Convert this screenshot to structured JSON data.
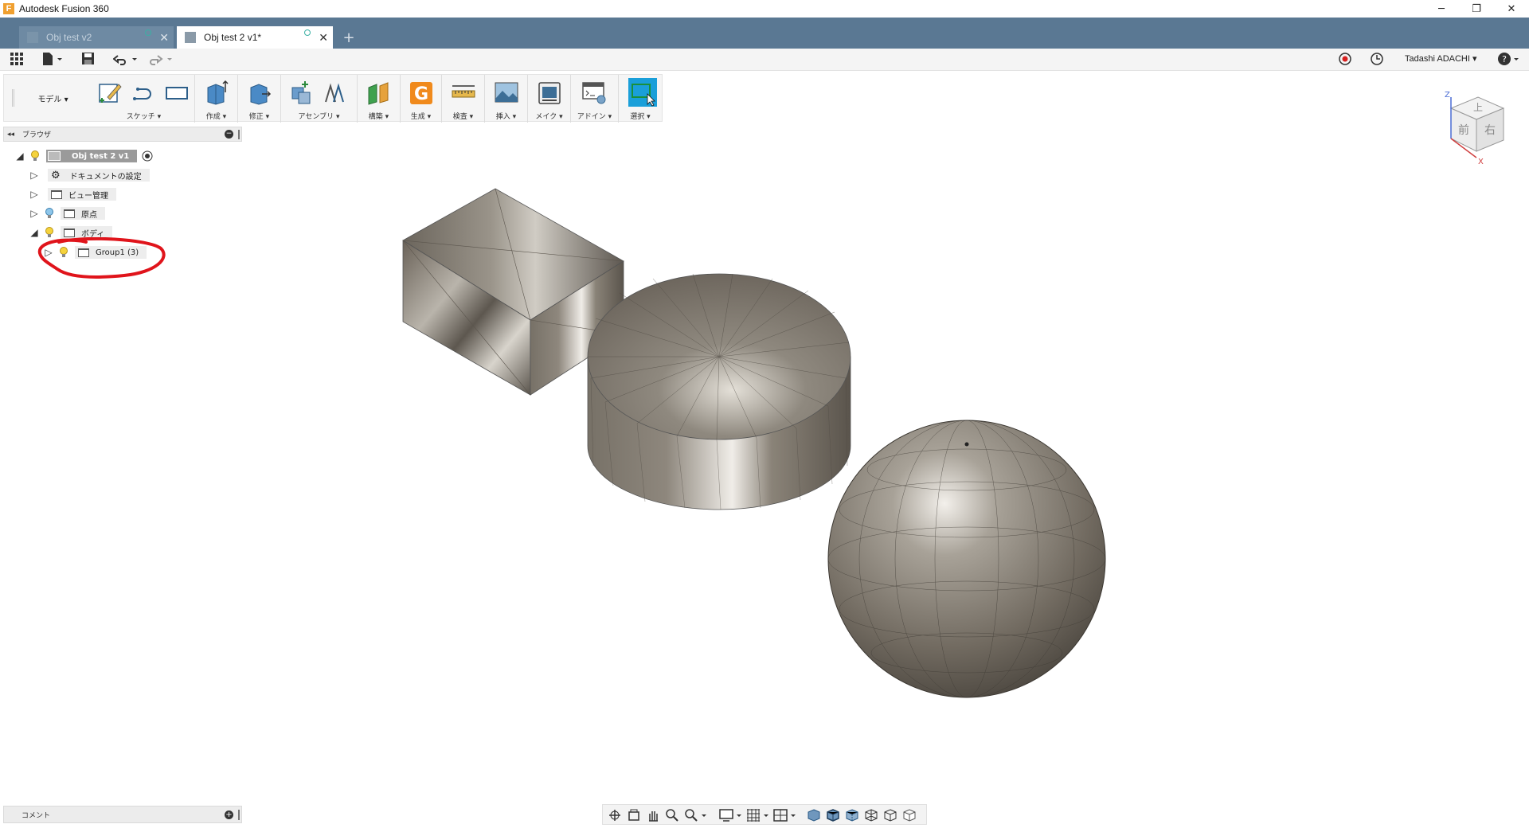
{
  "window": {
    "title": "Autodesk Fusion 360",
    "logo_letter": "F"
  },
  "window_controls": {
    "minimize": "─",
    "restore": "❐",
    "close": "✕"
  },
  "tabs": [
    {
      "label": "Obj test v2",
      "active": false
    },
    {
      "label": "Obj test 2 v1*",
      "active": true
    }
  ],
  "tab_add": "+",
  "quick_access": {
    "user": "Tadashi ADACHI ▾",
    "help": "?▾"
  },
  "toolbar": {
    "workspace": "モデル ▾",
    "groups": [
      {
        "label": "スケッチ ▾"
      },
      {
        "label": "作成 ▾"
      },
      {
        "label": "修正 ▾"
      },
      {
        "label": "アセンブリ ▾"
      },
      {
        "label": "構築 ▾"
      },
      {
        "label": "生成 ▾"
      },
      {
        "label": "検査 ▾"
      },
      {
        "label": "挿入 ▾"
      },
      {
        "label": "メイク ▾"
      },
      {
        "label": "アドイン ▾"
      },
      {
        "label": "選択 ▾"
      }
    ]
  },
  "browser": {
    "title": "ブラウザ",
    "collapse_glyph": "◂◂",
    "items": [
      {
        "label": "Obj test 2 v1"
      },
      {
        "label": "ドキュメントの設定"
      },
      {
        "label": "ビュー管理"
      },
      {
        "label": "原点"
      },
      {
        "label": "ボディ"
      },
      {
        "label": "Group1 (3)"
      }
    ]
  },
  "viewcube": {
    "top": "上",
    "front": "前",
    "right": "右",
    "axis_z": "Z",
    "axis_x": "X"
  },
  "comment": {
    "title": "コメント",
    "add": "+"
  },
  "colors": {
    "tabbar": "#5a7893",
    "accent": "#1a9fd9",
    "annotation": "#e0141b",
    "generate": "#f08a1c"
  }
}
